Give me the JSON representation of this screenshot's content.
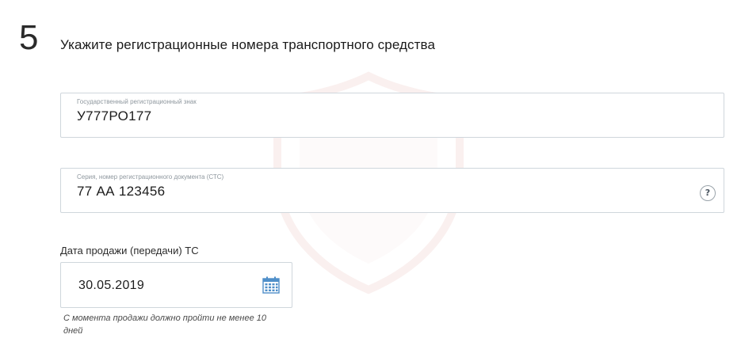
{
  "step": {
    "number": "5",
    "title": "Укажите регистрационные номера транспортного средства"
  },
  "plate_field": {
    "label": "Государственный регистрационный знак",
    "value": "У777РО177"
  },
  "sts_field": {
    "label": "Серия, номер регистрационного документа (СТС)",
    "value": "77 АА 123456",
    "help_icon_text": "?"
  },
  "date_field": {
    "label": "Дата продажи (передачи) ТС",
    "value": "30.05.2019",
    "hint": "С момента продажи должно пройти не менее 10 дней"
  },
  "icons": {
    "help": "question-circle-icon",
    "calendar": "calendar-icon",
    "watermark": "shield-watermark"
  },
  "colors": {
    "field_border": "#cfd6dc",
    "label_gray": "#8e979e",
    "calendar_blue": "#4f8fc9",
    "watermark": "#c0392b"
  }
}
